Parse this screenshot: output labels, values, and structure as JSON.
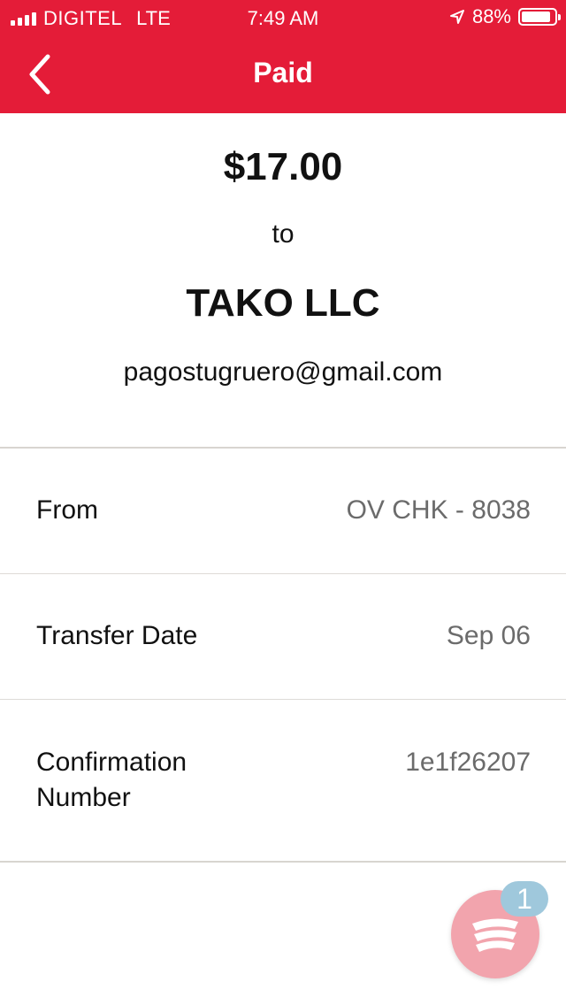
{
  "status_bar": {
    "carrier": "DIGITEL",
    "network": "LTE",
    "time": "7:49 AM",
    "battery": "88%",
    "battery_level": 0.88
  },
  "nav": {
    "title": "Paid",
    "back_icon": "chevron-left-icon"
  },
  "payment": {
    "amount": "$17.00",
    "to_label": "to",
    "payee": "TAKO LLC",
    "email": "pagostugruero@gmail.com"
  },
  "details": [
    {
      "label": "From",
      "value": "OV CHK - 8038"
    },
    {
      "label": "Transfer Date",
      "value": "Sep 06"
    },
    {
      "label": "Confirmation Number",
      "value": "1e1f26207"
    }
  ],
  "chat": {
    "icon": "flag-chat-icon",
    "badge_count": "1"
  },
  "colors": {
    "header": "#e41c38",
    "fab": "#f2a4ad",
    "badge": "#9fc8dc",
    "value_text": "#6b6b6b"
  }
}
